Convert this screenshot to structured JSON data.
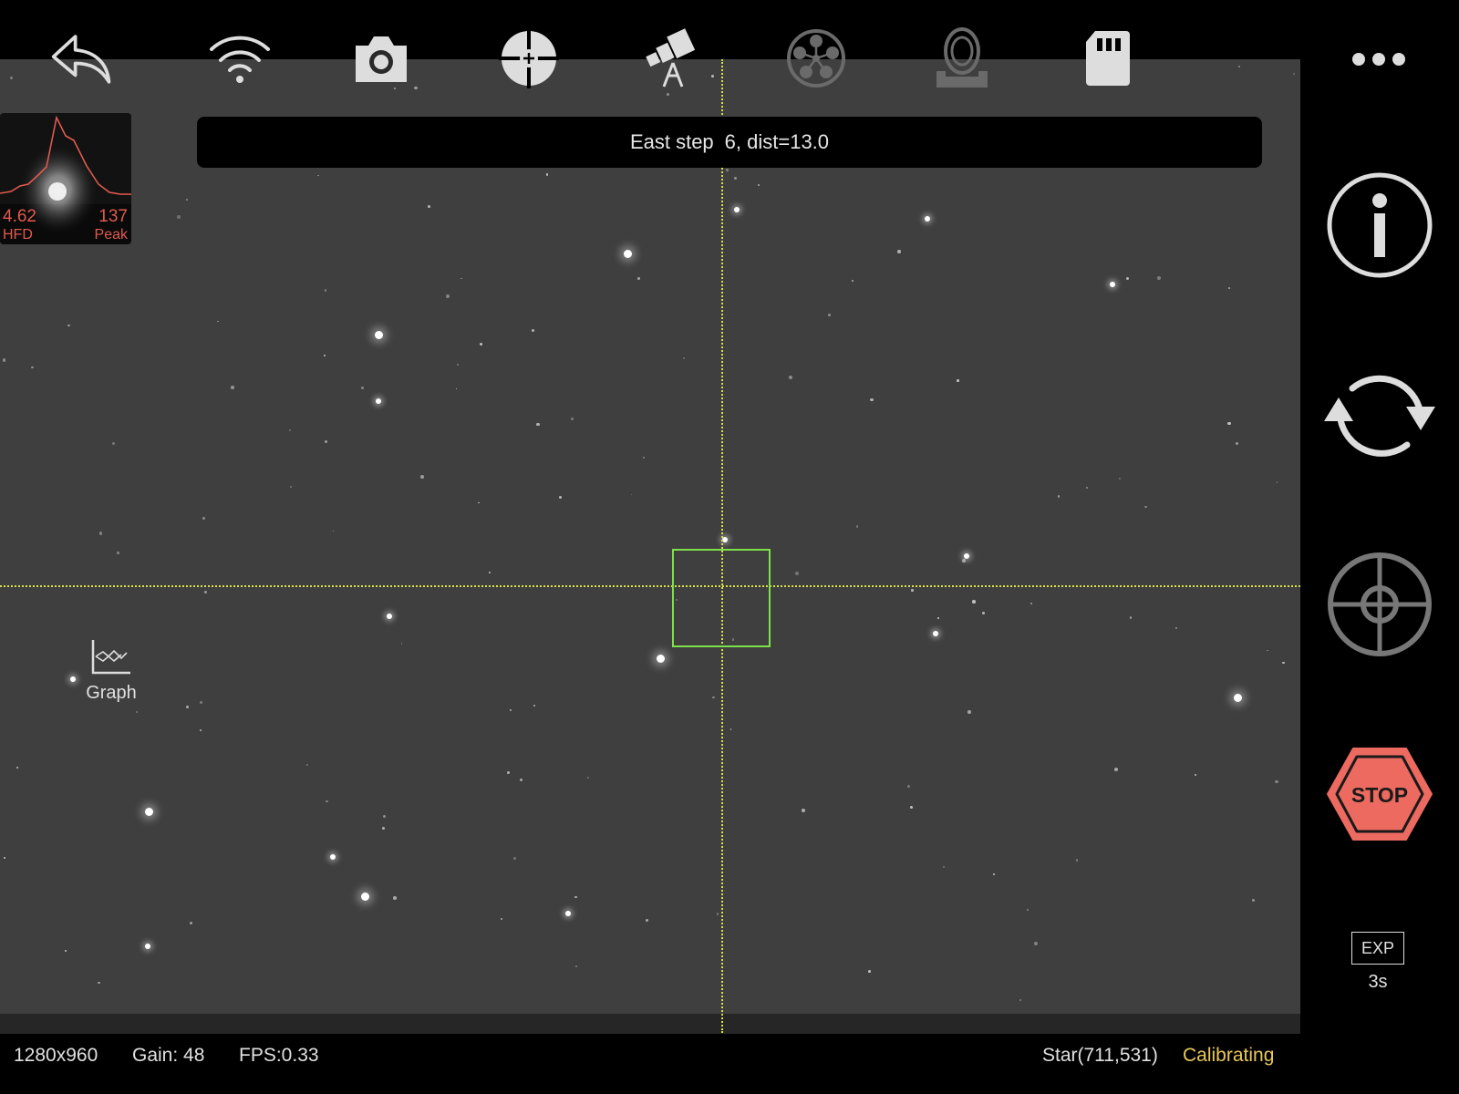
{
  "toolbar": {
    "icons": [
      {
        "name": "back-icon",
        "label": "Back"
      },
      {
        "name": "wifi-icon",
        "label": "Connection"
      },
      {
        "name": "camera-icon",
        "label": "Camera"
      },
      {
        "name": "guide-target-icon",
        "label": "Guider"
      },
      {
        "name": "telescope-icon",
        "label": "Mount"
      },
      {
        "name": "filter-wheel-icon",
        "label": "Filter wheel"
      },
      {
        "name": "focuser-icon",
        "label": "Focuser"
      },
      {
        "name": "sd-card-icon",
        "label": "Storage"
      }
    ],
    "more_icon": "more-icon"
  },
  "message": {
    "direction": "East step",
    "detail": "6, dist=13.0"
  },
  "star_profile": {
    "hfd_value": "4.62",
    "hfd_label": "HFD",
    "peak_value": "137",
    "peak_label": "Peak"
  },
  "graph_button": {
    "label": "Graph"
  },
  "status": {
    "resolution": "1280x960",
    "gain": "Gain: 48",
    "fps": "FPS:0.33",
    "star": "Star(711,531)",
    "state": "Calibrating"
  },
  "right_panel": {
    "info_icon": "info-icon",
    "loop_icon": "loop-icon",
    "target_icon": "target-icon",
    "stop_label": "STOP",
    "exposure_label": "EXP",
    "exposure_value": "3s"
  },
  "colors": {
    "crosshair": "#d8e04a",
    "star_box": "#7ee04a",
    "profile_red": "#e05a4e",
    "stop_red": "#ec6a60",
    "calibrating": "#e8c85a"
  }
}
